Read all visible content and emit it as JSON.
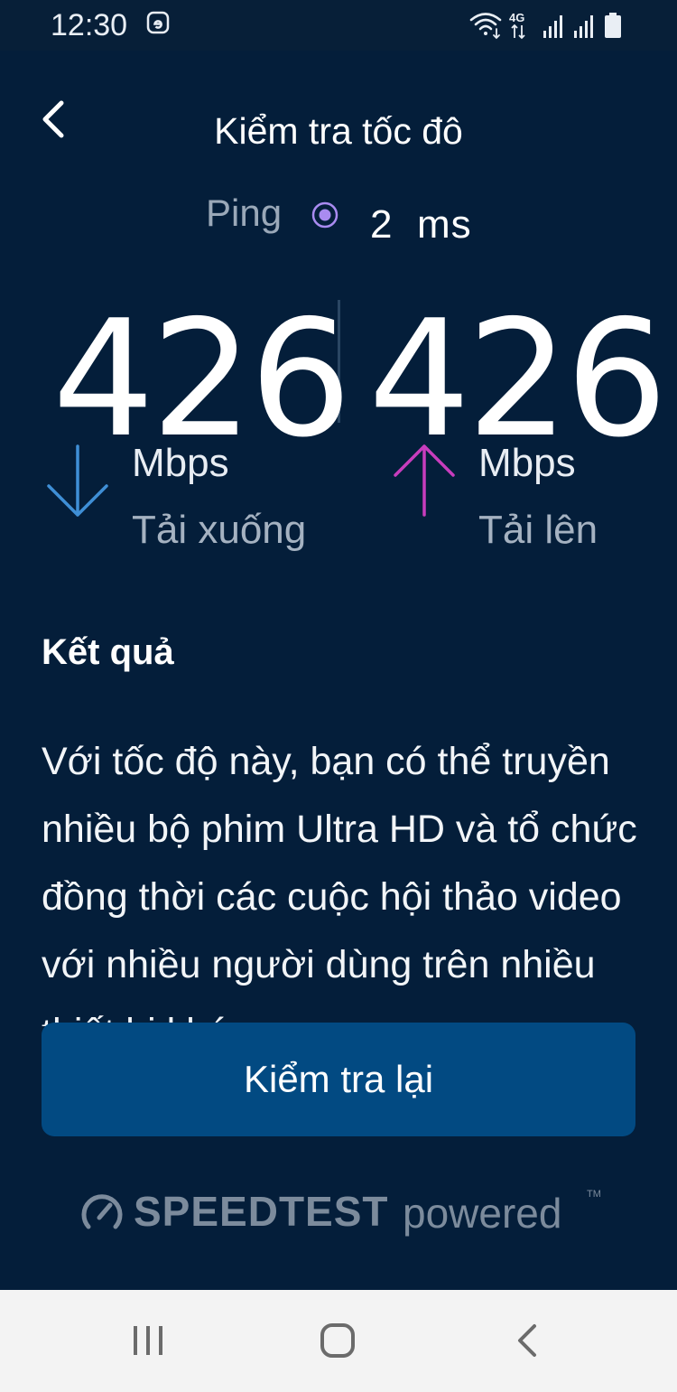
{
  "status_bar": {
    "time": "12:30",
    "network_label": "4G",
    "icons": [
      "e-notification-icon",
      "wifi-icon",
      "4g-icon",
      "signal-icon",
      "signal-icon",
      "battery-icon"
    ]
  },
  "header": {
    "title": "Kiểm tra tốc đô",
    "back_icon": "chevron-left-icon"
  },
  "ping": {
    "label": "Ping",
    "value": "2",
    "unit": "ms",
    "dot_color": "#a98bf0"
  },
  "download": {
    "value": "426",
    "unit": "Mbps",
    "label": "Tải xuống",
    "arrow_color": "#3f8fd6",
    "icon": "arrow-down-icon"
  },
  "upload": {
    "value": "426",
    "unit": "Mbps",
    "label": "Tải lên",
    "arrow_color": "#c83dbd",
    "icon": "arrow-up-icon"
  },
  "results": {
    "heading": "Kết quả",
    "text": "Với tốc độ này, bạn có thể truyền nhiều bộ phim Ultra HD và tổ chức đồng thời các cuộc hội thảo video với nhiều người dùng trên nhiều thiết bị khác"
  },
  "actions": {
    "retest_label": "Kiểm tra lại"
  },
  "branding": {
    "name": "SPEEDTEST",
    "suffix": "powered",
    "tm": "TM",
    "icon": "speedometer-icon"
  },
  "nav_bar": {
    "icons": [
      "recent-apps-icon",
      "home-icon",
      "back-icon"
    ]
  },
  "colors": {
    "background": "#041e3a",
    "button": "#024a82",
    "muted_text": "#a5b2c1"
  }
}
